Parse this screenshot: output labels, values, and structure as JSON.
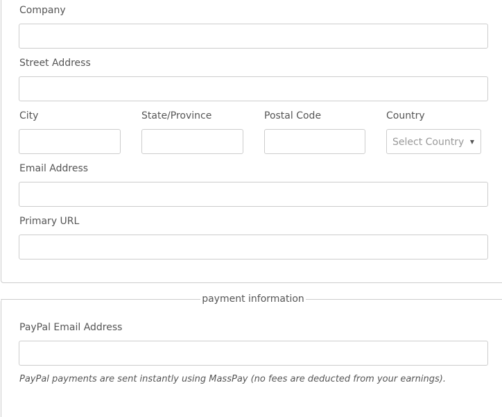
{
  "contact_section": {
    "company_label": "Company",
    "street_label": "Street Address",
    "city_label": "City",
    "state_label": "State/Province",
    "postal_label": "Postal Code",
    "country_label": "Country",
    "country_select": {
      "selected": "Select Country",
      "arrow_icon": "caret-down-icon"
    },
    "email_label": "Email Address",
    "url_label": "Primary URL"
  },
  "payment_section": {
    "legend": "payment information",
    "paypal_label": "PayPal Email Address",
    "note": "PayPal payments are sent instantly using MassPay (no fees are deducted from your earnings)."
  },
  "colors": {
    "border": "#cccccc",
    "text": "#555555",
    "placeholder": "#999999"
  }
}
